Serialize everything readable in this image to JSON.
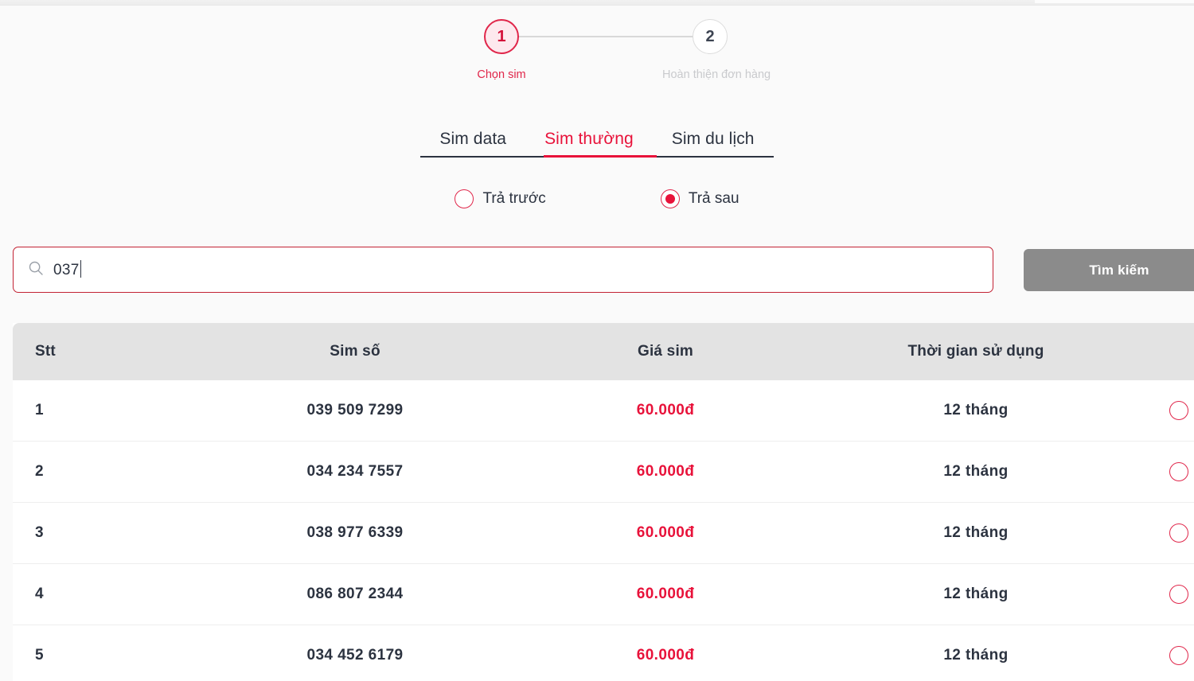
{
  "stepper": {
    "steps": [
      {
        "number": "1",
        "label": "Chọn sim",
        "state": "active"
      },
      {
        "number": "2",
        "label": "Hoàn thiện đơn hàng",
        "state": "inactive"
      }
    ]
  },
  "tabs": [
    {
      "label": "Sim data",
      "active": false
    },
    {
      "label": "Sim thường",
      "active": true
    },
    {
      "label": "Sim du lịch",
      "active": false
    }
  ],
  "pay_types": [
    {
      "label": "Trả trước",
      "checked": false
    },
    {
      "label": "Trả sau",
      "checked": true
    }
  ],
  "search": {
    "icon": "search-icon",
    "value": "037",
    "placeholder": "",
    "button_label": "Tìm kiếm"
  },
  "table": {
    "columns": [
      "Stt",
      "Sim số",
      "Giá sim",
      "Thời gian sử dụng",
      ""
    ],
    "rows": [
      {
        "stt": "1",
        "sim": "039 509 7299",
        "gia": "60.000đ",
        "time": "12 tháng",
        "selected": false
      },
      {
        "stt": "2",
        "sim": "034 234 7557",
        "gia": "60.000đ",
        "time": "12 tháng",
        "selected": false
      },
      {
        "stt": "3",
        "sim": "038 977 6339",
        "gia": "60.000đ",
        "time": "12 tháng",
        "selected": false
      },
      {
        "stt": "4",
        "sim": "086 807 2344",
        "gia": "60.000đ",
        "time": "12 tháng",
        "selected": false
      },
      {
        "stt": "5",
        "sim": "034 452 6179",
        "gia": "60.000đ",
        "time": "12 tháng",
        "selected": false
      }
    ]
  },
  "colors": {
    "brand_red": "#e8123a",
    "accent_pink": "#fde9ee",
    "step_border": "#e0264a",
    "text_dark": "#2c3340",
    "muted": "#c9cacd",
    "header_bg": "#e3e3e3",
    "button_gray": "#8b8b8b",
    "page_bg": "#fafafa"
  }
}
